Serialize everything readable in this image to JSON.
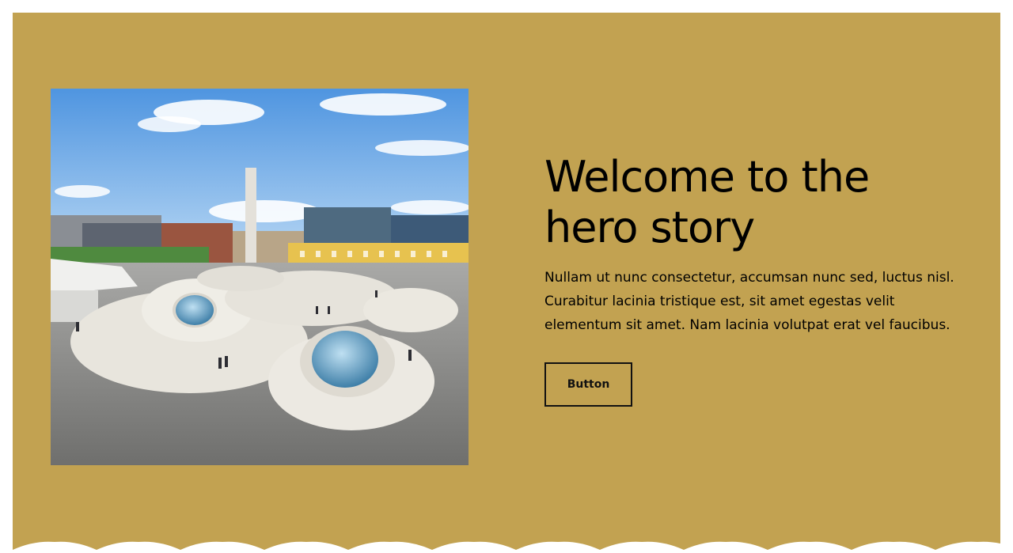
{
  "hero": {
    "title": "Welcome to the hero story",
    "text": "Nullam ut nunc consectetur, accumsan nunc sed, luctus nisl. Curabitur lacinia tristique est, sit amet egestas velit elementum sit amet. Nam lacinia volutpat erat vel faucibus.",
    "button_label": "Button",
    "image_icon": "photo-square-with-domes",
    "colors": {
      "background": "#c2a251",
      "text": "#000000",
      "page": "#ffffff"
    }
  }
}
